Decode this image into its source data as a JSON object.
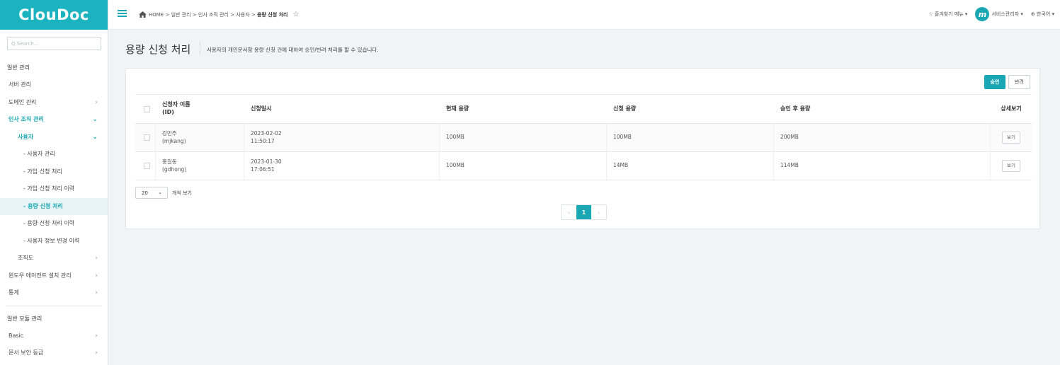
{
  "app": {
    "logo": "ClouDoc"
  },
  "sidebar": {
    "search_placeholder": "Q Search...",
    "section1": "일반 관리",
    "items": [
      {
        "label": "서버 관리",
        "chevron": ""
      },
      {
        "label": "도메인 관리",
        "chevron": "›"
      },
      {
        "label": "인사 조직 관리",
        "chevron": "⌄"
      },
      {
        "label": "사용자",
        "chevron": "⌄"
      },
      {
        "label": "- 사용자 관리"
      },
      {
        "label": "- 가입 신청 처리"
      },
      {
        "label": "- 가입 신청 처리 이력"
      },
      {
        "label": "- 용량 신청 처리"
      },
      {
        "label": "- 용량 신청 처리 이력"
      },
      {
        "label": "- 사용자 정보 변경 이력"
      },
      {
        "label": "조직도",
        "chevron": "›"
      },
      {
        "label": "윈도우 에이전트 설치 관리",
        "chevron": "›"
      },
      {
        "label": "통계",
        "chevron": "›"
      }
    ],
    "section2": "일반 모듈 관리",
    "items2": [
      {
        "label": "Basic",
        "chevron": "›"
      },
      {
        "label": "문서 보안 등급",
        "chevron": "›"
      }
    ]
  },
  "topbar": {
    "breadcrumb": [
      "HOME",
      "일반 관리",
      "인사 조직 관리",
      "사용자"
    ],
    "breadcrumb_sep": " > ",
    "breadcrumb_current": "용량 신청 처리",
    "favorites": "☆ 즐겨찾기 메뉴 ▾",
    "avatar_letter": "m",
    "user": "서비스관리자 ▾",
    "language": "⊕ 한국어 ▾"
  },
  "page": {
    "title": "용량 신청 처리",
    "description": "사용자의 개인문서함 용량 신청 건에 대하여 승인/반려 처리를 할 수 있습니다."
  },
  "actions": {
    "approve": "승인",
    "reject": "반려"
  },
  "table": {
    "headers": {
      "name": "신청자 이름",
      "name_id": "(ID)",
      "date": "신청일시",
      "current": "현재 용량",
      "requested": "신청 용량",
      "after": "승인 후 용량",
      "detail": "상세보기"
    },
    "rows": [
      {
        "name": "강민주",
        "id": "(mjkang)",
        "date": "2023-02-02",
        "time": "11:50:17",
        "current": "100MB",
        "requested": "100MB",
        "after": "200MB",
        "view": "보기"
      },
      {
        "name": "홍길동",
        "id": "(gdhong)",
        "date": "2023-01-30",
        "time": "17:06:51",
        "current": "100MB",
        "requested": "14MB",
        "after": "114MB",
        "view": "보기"
      }
    ]
  },
  "pagination": {
    "page_size": "20",
    "page_size_label": "개씩 보기",
    "prev": "‹",
    "current": "1",
    "next": "›"
  },
  "colors": {
    "accent": "#19a7b3",
    "logo_bg": "#1ab3bf"
  }
}
